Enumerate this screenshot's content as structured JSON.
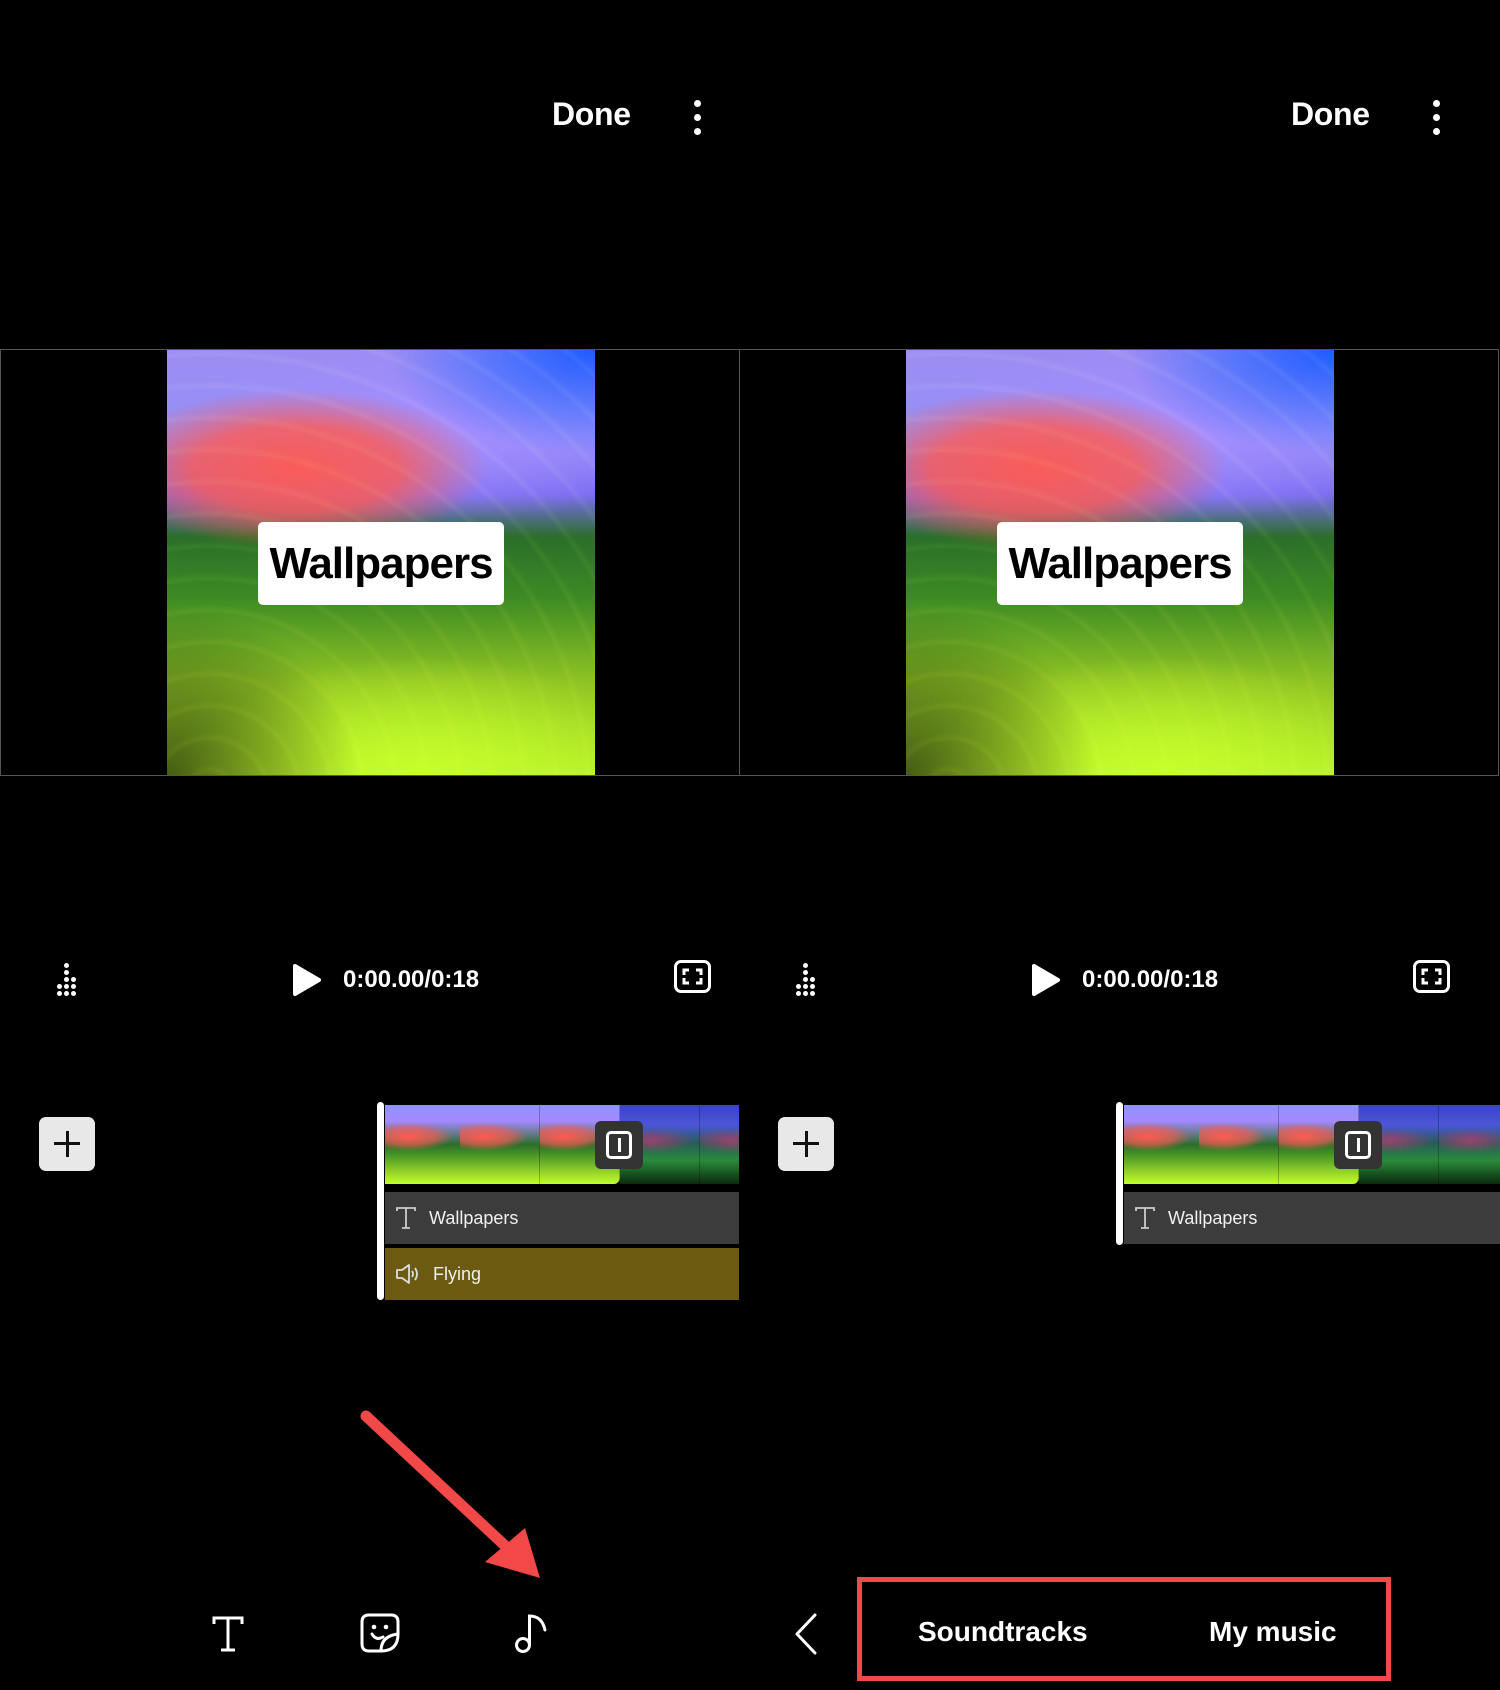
{
  "left_panel": {
    "header": {
      "done_label": "Done",
      "more_icon": "more-vertical-icon"
    },
    "preview": {
      "caption_text": "Wallpapers"
    },
    "controls": {
      "time_display": "0:00.00/0:18",
      "play_icon": "play-icon",
      "fullscreen_icon": "fullscreen-icon",
      "dots_icon": "level-dots-icon"
    },
    "timeline": {
      "add_icon": "plus-icon",
      "transition_icon": "transition-icon",
      "tracks": [
        {
          "type": "text",
          "icon": "text-icon",
          "label": "Wallpapers"
        },
        {
          "type": "audio",
          "icon": "speaker-icon",
          "label": "Flying"
        }
      ]
    },
    "bottom_toolbar": [
      {
        "name": "text",
        "icon": "text-icon"
      },
      {
        "name": "sticker",
        "icon": "sticker-icon"
      },
      {
        "name": "music",
        "icon": "music-note-icon"
      }
    ]
  },
  "right_panel": {
    "header": {
      "done_label": "Done",
      "more_icon": "more-vertical-icon"
    },
    "preview": {
      "caption_text": "Wallpapers"
    },
    "controls": {
      "time_display": "0:00.00/0:18"
    },
    "timeline": {
      "tracks": [
        {
          "type": "text",
          "icon": "text-icon",
          "label": "Wallpapers"
        }
      ]
    },
    "music_menu": {
      "back_icon": "chevron-left-icon",
      "tabs": [
        {
          "label": "Soundtracks"
        },
        {
          "label": "My music"
        }
      ]
    }
  },
  "annotations": {
    "arrow_color": "#f24848",
    "highlight_color": "#f24848",
    "audio_track_color": "#6b5a10",
    "text_track_color": "#3c3c3c"
  }
}
